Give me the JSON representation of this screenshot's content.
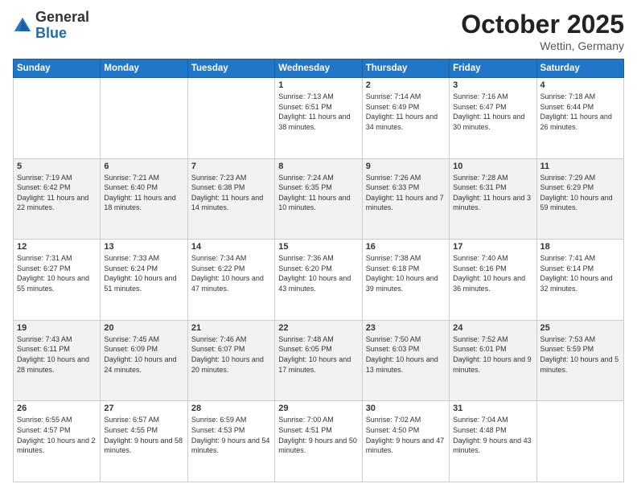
{
  "header": {
    "logo_general": "General",
    "logo_blue": "Blue",
    "month": "October 2025",
    "location": "Wettin, Germany"
  },
  "weekdays": [
    "Sunday",
    "Monday",
    "Tuesday",
    "Wednesday",
    "Thursday",
    "Friday",
    "Saturday"
  ],
  "weeks": [
    [
      {
        "day": "",
        "info": ""
      },
      {
        "day": "",
        "info": ""
      },
      {
        "day": "",
        "info": ""
      },
      {
        "day": "1",
        "info": "Sunrise: 7:13 AM\nSunset: 6:51 PM\nDaylight: 11 hours and 38 minutes."
      },
      {
        "day": "2",
        "info": "Sunrise: 7:14 AM\nSunset: 6:49 PM\nDaylight: 11 hours and 34 minutes."
      },
      {
        "day": "3",
        "info": "Sunrise: 7:16 AM\nSunset: 6:47 PM\nDaylight: 11 hours and 30 minutes."
      },
      {
        "day": "4",
        "info": "Sunrise: 7:18 AM\nSunset: 6:44 PM\nDaylight: 11 hours and 26 minutes."
      }
    ],
    [
      {
        "day": "5",
        "info": "Sunrise: 7:19 AM\nSunset: 6:42 PM\nDaylight: 11 hours and 22 minutes."
      },
      {
        "day": "6",
        "info": "Sunrise: 7:21 AM\nSunset: 6:40 PM\nDaylight: 11 hours and 18 minutes."
      },
      {
        "day": "7",
        "info": "Sunrise: 7:23 AM\nSunset: 6:38 PM\nDaylight: 11 hours and 14 minutes."
      },
      {
        "day": "8",
        "info": "Sunrise: 7:24 AM\nSunset: 6:35 PM\nDaylight: 11 hours and 10 minutes."
      },
      {
        "day": "9",
        "info": "Sunrise: 7:26 AM\nSunset: 6:33 PM\nDaylight: 11 hours and 7 minutes."
      },
      {
        "day": "10",
        "info": "Sunrise: 7:28 AM\nSunset: 6:31 PM\nDaylight: 11 hours and 3 minutes."
      },
      {
        "day": "11",
        "info": "Sunrise: 7:29 AM\nSunset: 6:29 PM\nDaylight: 10 hours and 59 minutes."
      }
    ],
    [
      {
        "day": "12",
        "info": "Sunrise: 7:31 AM\nSunset: 6:27 PM\nDaylight: 10 hours and 55 minutes."
      },
      {
        "day": "13",
        "info": "Sunrise: 7:33 AM\nSunset: 6:24 PM\nDaylight: 10 hours and 51 minutes."
      },
      {
        "day": "14",
        "info": "Sunrise: 7:34 AM\nSunset: 6:22 PM\nDaylight: 10 hours and 47 minutes."
      },
      {
        "day": "15",
        "info": "Sunrise: 7:36 AM\nSunset: 6:20 PM\nDaylight: 10 hours and 43 minutes."
      },
      {
        "day": "16",
        "info": "Sunrise: 7:38 AM\nSunset: 6:18 PM\nDaylight: 10 hours and 39 minutes."
      },
      {
        "day": "17",
        "info": "Sunrise: 7:40 AM\nSunset: 6:16 PM\nDaylight: 10 hours and 36 minutes."
      },
      {
        "day": "18",
        "info": "Sunrise: 7:41 AM\nSunset: 6:14 PM\nDaylight: 10 hours and 32 minutes."
      }
    ],
    [
      {
        "day": "19",
        "info": "Sunrise: 7:43 AM\nSunset: 6:11 PM\nDaylight: 10 hours and 28 minutes."
      },
      {
        "day": "20",
        "info": "Sunrise: 7:45 AM\nSunset: 6:09 PM\nDaylight: 10 hours and 24 minutes."
      },
      {
        "day": "21",
        "info": "Sunrise: 7:46 AM\nSunset: 6:07 PM\nDaylight: 10 hours and 20 minutes."
      },
      {
        "day": "22",
        "info": "Sunrise: 7:48 AM\nSunset: 6:05 PM\nDaylight: 10 hours and 17 minutes."
      },
      {
        "day": "23",
        "info": "Sunrise: 7:50 AM\nSunset: 6:03 PM\nDaylight: 10 hours and 13 minutes."
      },
      {
        "day": "24",
        "info": "Sunrise: 7:52 AM\nSunset: 6:01 PM\nDaylight: 10 hours and 9 minutes."
      },
      {
        "day": "25",
        "info": "Sunrise: 7:53 AM\nSunset: 5:59 PM\nDaylight: 10 hours and 5 minutes."
      }
    ],
    [
      {
        "day": "26",
        "info": "Sunrise: 6:55 AM\nSunset: 4:57 PM\nDaylight: 10 hours and 2 minutes."
      },
      {
        "day": "27",
        "info": "Sunrise: 6:57 AM\nSunset: 4:55 PM\nDaylight: 9 hours and 58 minutes."
      },
      {
        "day": "28",
        "info": "Sunrise: 6:59 AM\nSunset: 4:53 PM\nDaylight: 9 hours and 54 minutes."
      },
      {
        "day": "29",
        "info": "Sunrise: 7:00 AM\nSunset: 4:51 PM\nDaylight: 9 hours and 50 minutes."
      },
      {
        "day": "30",
        "info": "Sunrise: 7:02 AM\nSunset: 4:50 PM\nDaylight: 9 hours and 47 minutes."
      },
      {
        "day": "31",
        "info": "Sunrise: 7:04 AM\nSunset: 4:48 PM\nDaylight: 9 hours and 43 minutes."
      },
      {
        "day": "",
        "info": ""
      }
    ]
  ]
}
